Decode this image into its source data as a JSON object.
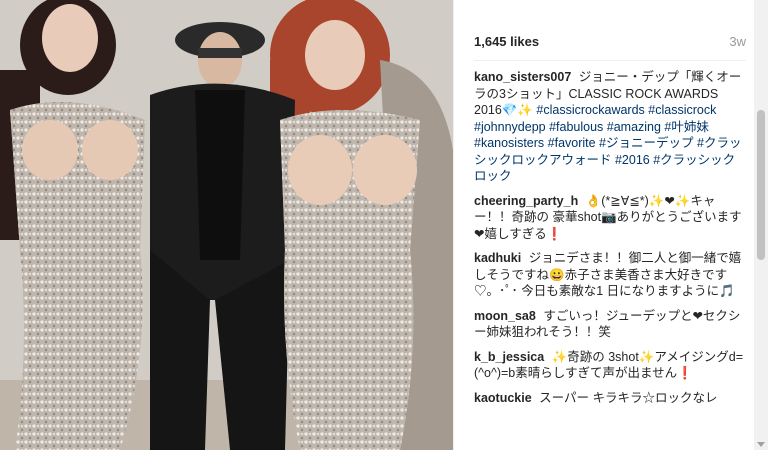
{
  "post": {
    "likes": "1,645 likes",
    "age": "3w"
  },
  "caption": {
    "user": "kano_sisters007",
    "text": "ジョニー・デップ「輝くオーラの3ショット」CLASSIC ROCK AWARDS 2016💎✨",
    "hashtags": "#classicrockawards #classicrock #johnnydepp #fabulous #amazing #叶姉妹 #kanosisters #favorite #ジョニーデップ #クラッシックロックアウォード #2016 #クラッシックロック"
  },
  "comments": [
    {
      "user": "cheering_party_h",
      "text": "👌(*≧∀≦*)✨❤✨キャー！！奇跡の 豪華shot📷ありがとうございます❤嬉しすぎる❗"
    },
    {
      "user": "kadhuki",
      "text": "ジョニデさま！！御二人と御一緒で嬉しそうですね😀赤子さま美香さま大好きです♡。･ﾟ･ 今日も素敵な1 日になりますように🎵"
    },
    {
      "user": "moon_sa8",
      "text": "すごいっ！ジューデップと❤セクシー姉妹狙われそう！！笑"
    },
    {
      "user": "k_b_jessica",
      "text": "✨奇跡の 3shot✨アメイジングd=(^o^)=b素晴らしすぎて声が出ません❗"
    },
    {
      "user": "kaotuckie",
      "text": "スーパー キラキラ☆ロックなレ"
    }
  ],
  "colors": {
    "link": "#003569",
    "muted": "#999999"
  },
  "photo": {
    "subject": "three people posing at an event"
  }
}
